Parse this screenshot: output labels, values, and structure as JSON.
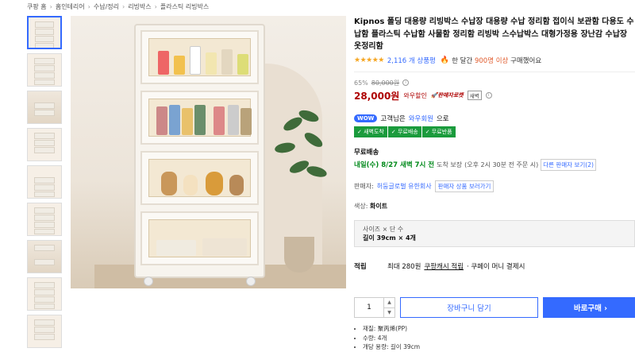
{
  "breadcrumb": [
    "쿠팡 홈",
    "홈인테리어",
    "수납/정리",
    "리빙박스",
    "플라스틱 리빙박스"
  ],
  "product": {
    "title": "Kipnos 폴딩 대용량 리빙박스 수납장 대용량 수납 정리함 접이식 보관함 다용도 수납함 플라스틱 수납함 사물함 정리함 리빙박 스수납박스 대형가정용 장난감 수납장 옷정리함",
    "stars": "★★★★★",
    "review_count": "2,116 개 상품평",
    "month_prefix": "한 달간",
    "month_count": "900명 이상",
    "month_suffix": "구매했어요"
  },
  "price": {
    "discount": "65%",
    "original": "80,000원",
    "sale": "28,000원",
    "sale_label": "와우할인",
    "rocket": "🚀판매자로켓",
    "new_badge": "새벽"
  },
  "wow": {
    "pill": "WOW",
    "text_prefix": "고객님은",
    "link": "와우회원",
    "text_suffix": "으로",
    "benefits": [
      "✓ 새벽도착",
      "✓ 무료배송",
      "✓ 무료반품"
    ]
  },
  "shipping": {
    "title": "무료배송",
    "arrival": "내일(수) 8/27 새벽 7시 전",
    "arrival_suffix": "도착 보장",
    "cutoff": "(오후 2시 30분 전 주문 시)",
    "other_sellers": "다른 판매자 보기(2)"
  },
  "seller": {
    "label": "판매자:",
    "name": "허둥글로벌 유한회사",
    "button": "판매자 상품 보러가기"
  },
  "color": {
    "label": "색상:",
    "value": "화이트"
  },
  "option": {
    "label": "사이즈 × 단 수",
    "value": "길이 39cm × 4개"
  },
  "earn": {
    "label": "적립",
    "text": "최대 280원",
    "link": "쿠팡캐시 적립",
    "suffix": "· 쿠페이 머니 결제시"
  },
  "purchase": {
    "quantity": "1",
    "cart_label": "장바구니 담기",
    "buy_label": "바로구매 ›"
  },
  "specs": [
    "재질: 聚丙烯(PP)",
    "수량: 4개",
    "개당 용량: 길이 39cm"
  ],
  "icons": {
    "up": "▲",
    "down": "▼",
    "fire": "🔥",
    "info": "i"
  }
}
